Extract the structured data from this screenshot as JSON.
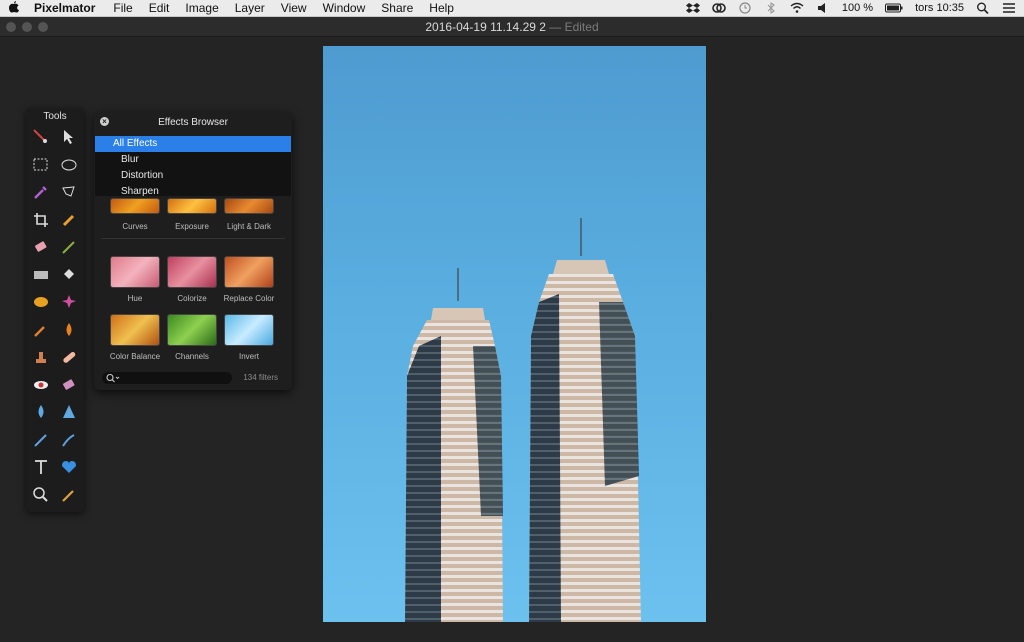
{
  "menubar": {
    "app_name": "Pixelmator",
    "items": [
      "File",
      "Edit",
      "Image",
      "Layer",
      "View",
      "Window",
      "Share",
      "Help"
    ],
    "battery": "100 %",
    "clock": "tors 10:35"
  },
  "window": {
    "title": "2016-04-19 11.14.29 2",
    "edited": " — Edited"
  },
  "tools_panel": {
    "title": "Tools"
  },
  "effects_browser": {
    "title": "Effects Browser",
    "categories": [
      "All Effects",
      "Blur",
      "Distortion",
      "Sharpen"
    ],
    "effects": [
      "Curves",
      "Exposure",
      "Light & Dark",
      "Hue",
      "Colorize",
      "Replace Color",
      "Color Balance",
      "Channels",
      "Invert"
    ],
    "filter_count": "134 filters"
  },
  "colors": {
    "accent": "#2a7fe8",
    "sky_top": "#4e9bd0",
    "sky_bottom": "#6cc1ef"
  }
}
